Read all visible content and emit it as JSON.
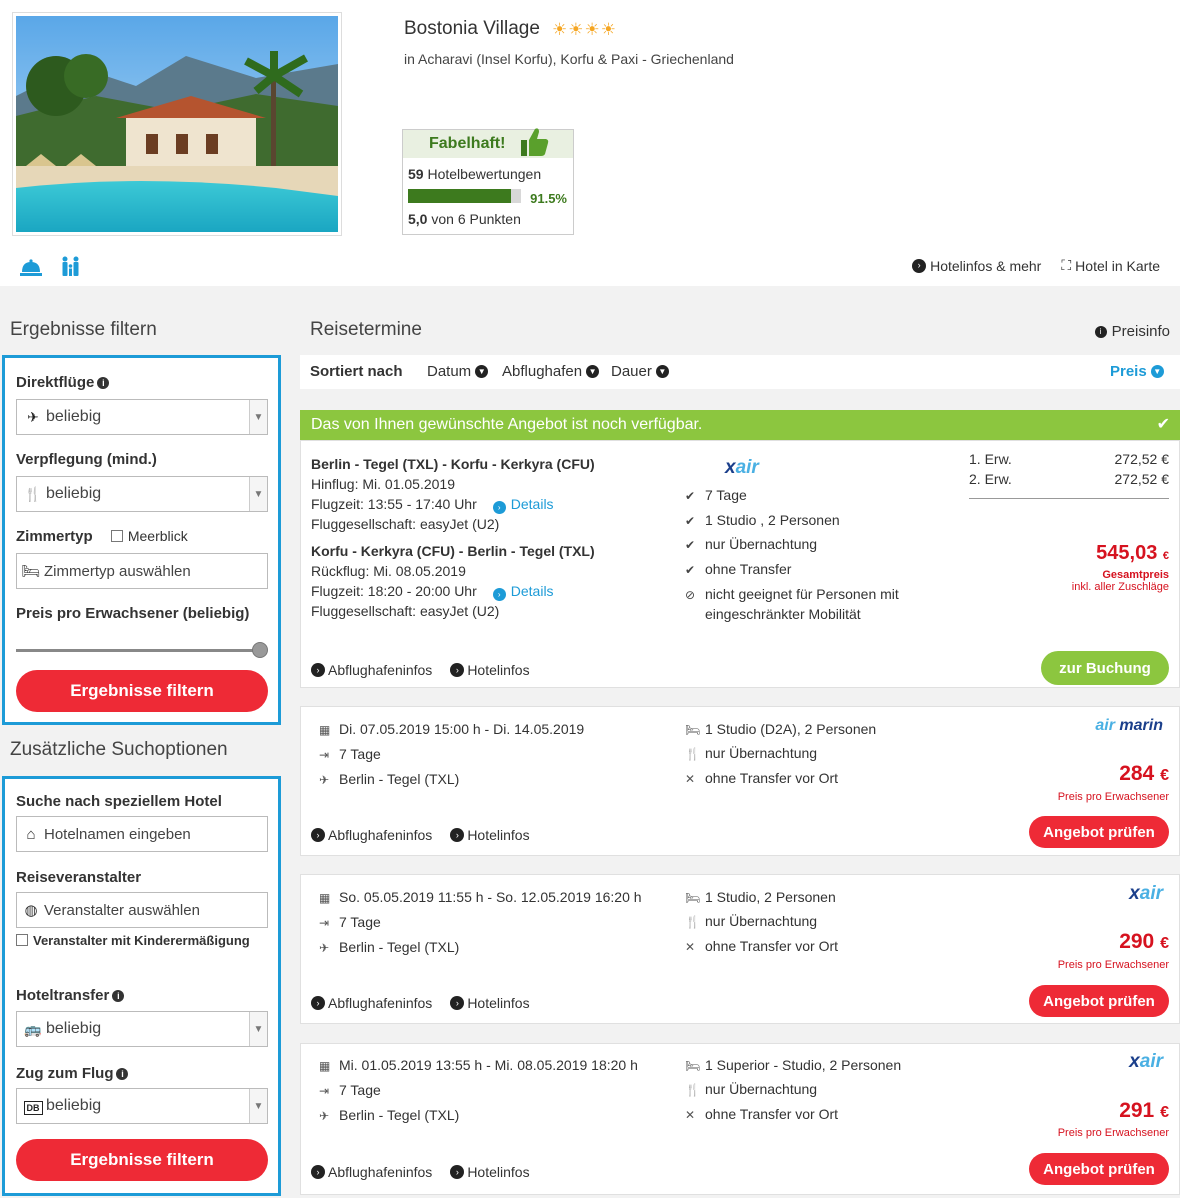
{
  "hotel": {
    "name": "Bostonia Village",
    "stars": "☀☀☀☀",
    "location": "in Acharavi (Insel Korfu), Korfu & Paxi - Griechenland",
    "rating_label": "Fabelhaft!",
    "reviews_count": "59",
    "reviews_label": "Hotelbewertungen",
    "rating_percent": 91.5,
    "rating_percent_text": "91.5%",
    "score": "5,0",
    "score_label": "von 6 Punkten"
  },
  "header_links": {
    "hotelinfos": "Hotelinfos & mehr",
    "karte": "Hotel in Karte"
  },
  "filter": {
    "title": "Ergebnisse filtern",
    "direktfluege_label": "Direktflüge",
    "direktfluege_value": "beliebig",
    "verpflegung_label": "Verpflegung (mind.)",
    "verpflegung_value": "beliebig",
    "zimmertyp_label": "Zimmertyp",
    "meerblick_label": "Meerblick",
    "zimmertyp_placeholder": "Zimmertyp auswählen",
    "preis_label": "Preis pro Erwachsener (beliebig)",
    "preis_slider_value": 1.0,
    "submit_label": "Ergebnisse filtern"
  },
  "extra": {
    "title": "Zusätzliche Suchoptionen",
    "hotel_label": "Suche nach speziellem Hotel",
    "hotel_placeholder": "Hotelnamen eingeben",
    "veranstalter_label": "Reiseveranstalter",
    "veranstalter_placeholder": "Veranstalter auswählen",
    "kinder_label": "Veranstalter mit Kinderermäßigung",
    "transfer_label": "Hoteltransfer",
    "transfer_value": "beliebig",
    "zug_label": "Zug zum Flug",
    "zug_icon_text": "DB",
    "zug_value": "beliebig",
    "submit_label": "Ergebnisse filtern"
  },
  "results": {
    "title": "Reisetermine",
    "preisinfo": "Preisinfo",
    "sort_label": "Sortiert nach",
    "sort": {
      "datum": "Datum",
      "abflughafen": "Abflughafen",
      "dauer": "Dauer",
      "preis": "Preis"
    },
    "banner": "Das von Ihnen gewünschte Angebot ist noch verfügbar."
  },
  "featured": {
    "outbound_route": "Berlin - Tegel (TXL) - Korfu - Kerkyra (CFU)",
    "outbound_date": "Hinflug: Mi. 01.05.2019",
    "outbound_time": "Flugzeit: 13:55 - 17:40 Uhr",
    "outbound_airline": "Fluggesellschaft: easyJet (U2)",
    "return_route": "Korfu - Kerkyra (CFU) - Berlin - Tegel (TXL)",
    "return_date": "Rückflug: Mi. 08.05.2019",
    "return_time": "Flugzeit: 18:20 - 20:00 Uhr",
    "return_airline": "Fluggesellschaft: easyJet (U2)",
    "details": "Details",
    "airline_x": "x",
    "airline_rest": "air",
    "features": [
      "7 Tage",
      "1 Studio , 2 Personen",
      "nur Übernachtung",
      "ohne Transfer"
    ],
    "mobility_1": "nicht geeignet für Personen mit",
    "mobility_2": "eingeschränkter Mobilität",
    "p1_label": "1. Erw.",
    "p1_value": "272,52 €",
    "p2_label": "2. Erw.",
    "p2_value": "272,52 €",
    "total": "545,03",
    "currency": "€",
    "total_label": "Gesamtpreis",
    "total_sub": "inkl. aller Zuschläge",
    "book_label": "zur Buchung",
    "link1": "Abflughafeninfos",
    "link2": "Hotelinfos"
  },
  "offers": [
    {
      "dates": "Di. 07.05.2019 15:00 h - Di. 14.05.2019",
      "duration": "7 Tage",
      "airport": "Berlin - Tegel (TXL)",
      "room": "1 Studio (D2A), 2 Personen",
      "board": "nur Übernachtung",
      "transfer": "ohne Transfer vor Ort",
      "airline_a": "air",
      "airline_b": "marin",
      "price": "284",
      "currency": "€",
      "price_label": "Preis pro Erwachsener",
      "btn": "Angebot prüfen",
      "link1": "Abflughafeninfos",
      "link2": "Hotelinfos"
    },
    {
      "dates": "So. 05.05.2019 11:55 h - So. 12.05.2019 16:20 h",
      "duration": "7 Tage",
      "airport": "Berlin - Tegel (TXL)",
      "room": "1 Studio, 2 Personen",
      "board": "nur Übernachtung",
      "transfer": "ohne Transfer vor Ort",
      "airline_a": "x",
      "airline_b": "air",
      "price": "290",
      "currency": "€",
      "price_label": "Preis pro Erwachsener",
      "btn": "Angebot prüfen",
      "link1": "Abflughafeninfos",
      "link2": "Hotelinfos"
    },
    {
      "dates": "Mi. 01.05.2019 13:55 h - Mi. 08.05.2019 18:20 h",
      "duration": "7 Tage",
      "airport": "Berlin - Tegel (TXL)",
      "room": "1 Superior - Studio, 2 Personen",
      "board": "nur Übernachtung",
      "transfer": "ohne Transfer vor Ort",
      "airline_a": "x",
      "airline_b": "air",
      "price": "291",
      "currency": "€",
      "price_label": "Preis pro Erwachsener",
      "btn": "Angebot prüfen",
      "link1": "Abflughafeninfos",
      "link2": "Hotelinfos"
    }
  ],
  "colors": {
    "accent_blue": "#1d9bd7",
    "red": "#ee2a36",
    "green": "#8cc63f",
    "rating_green": "#3d7a1e"
  }
}
